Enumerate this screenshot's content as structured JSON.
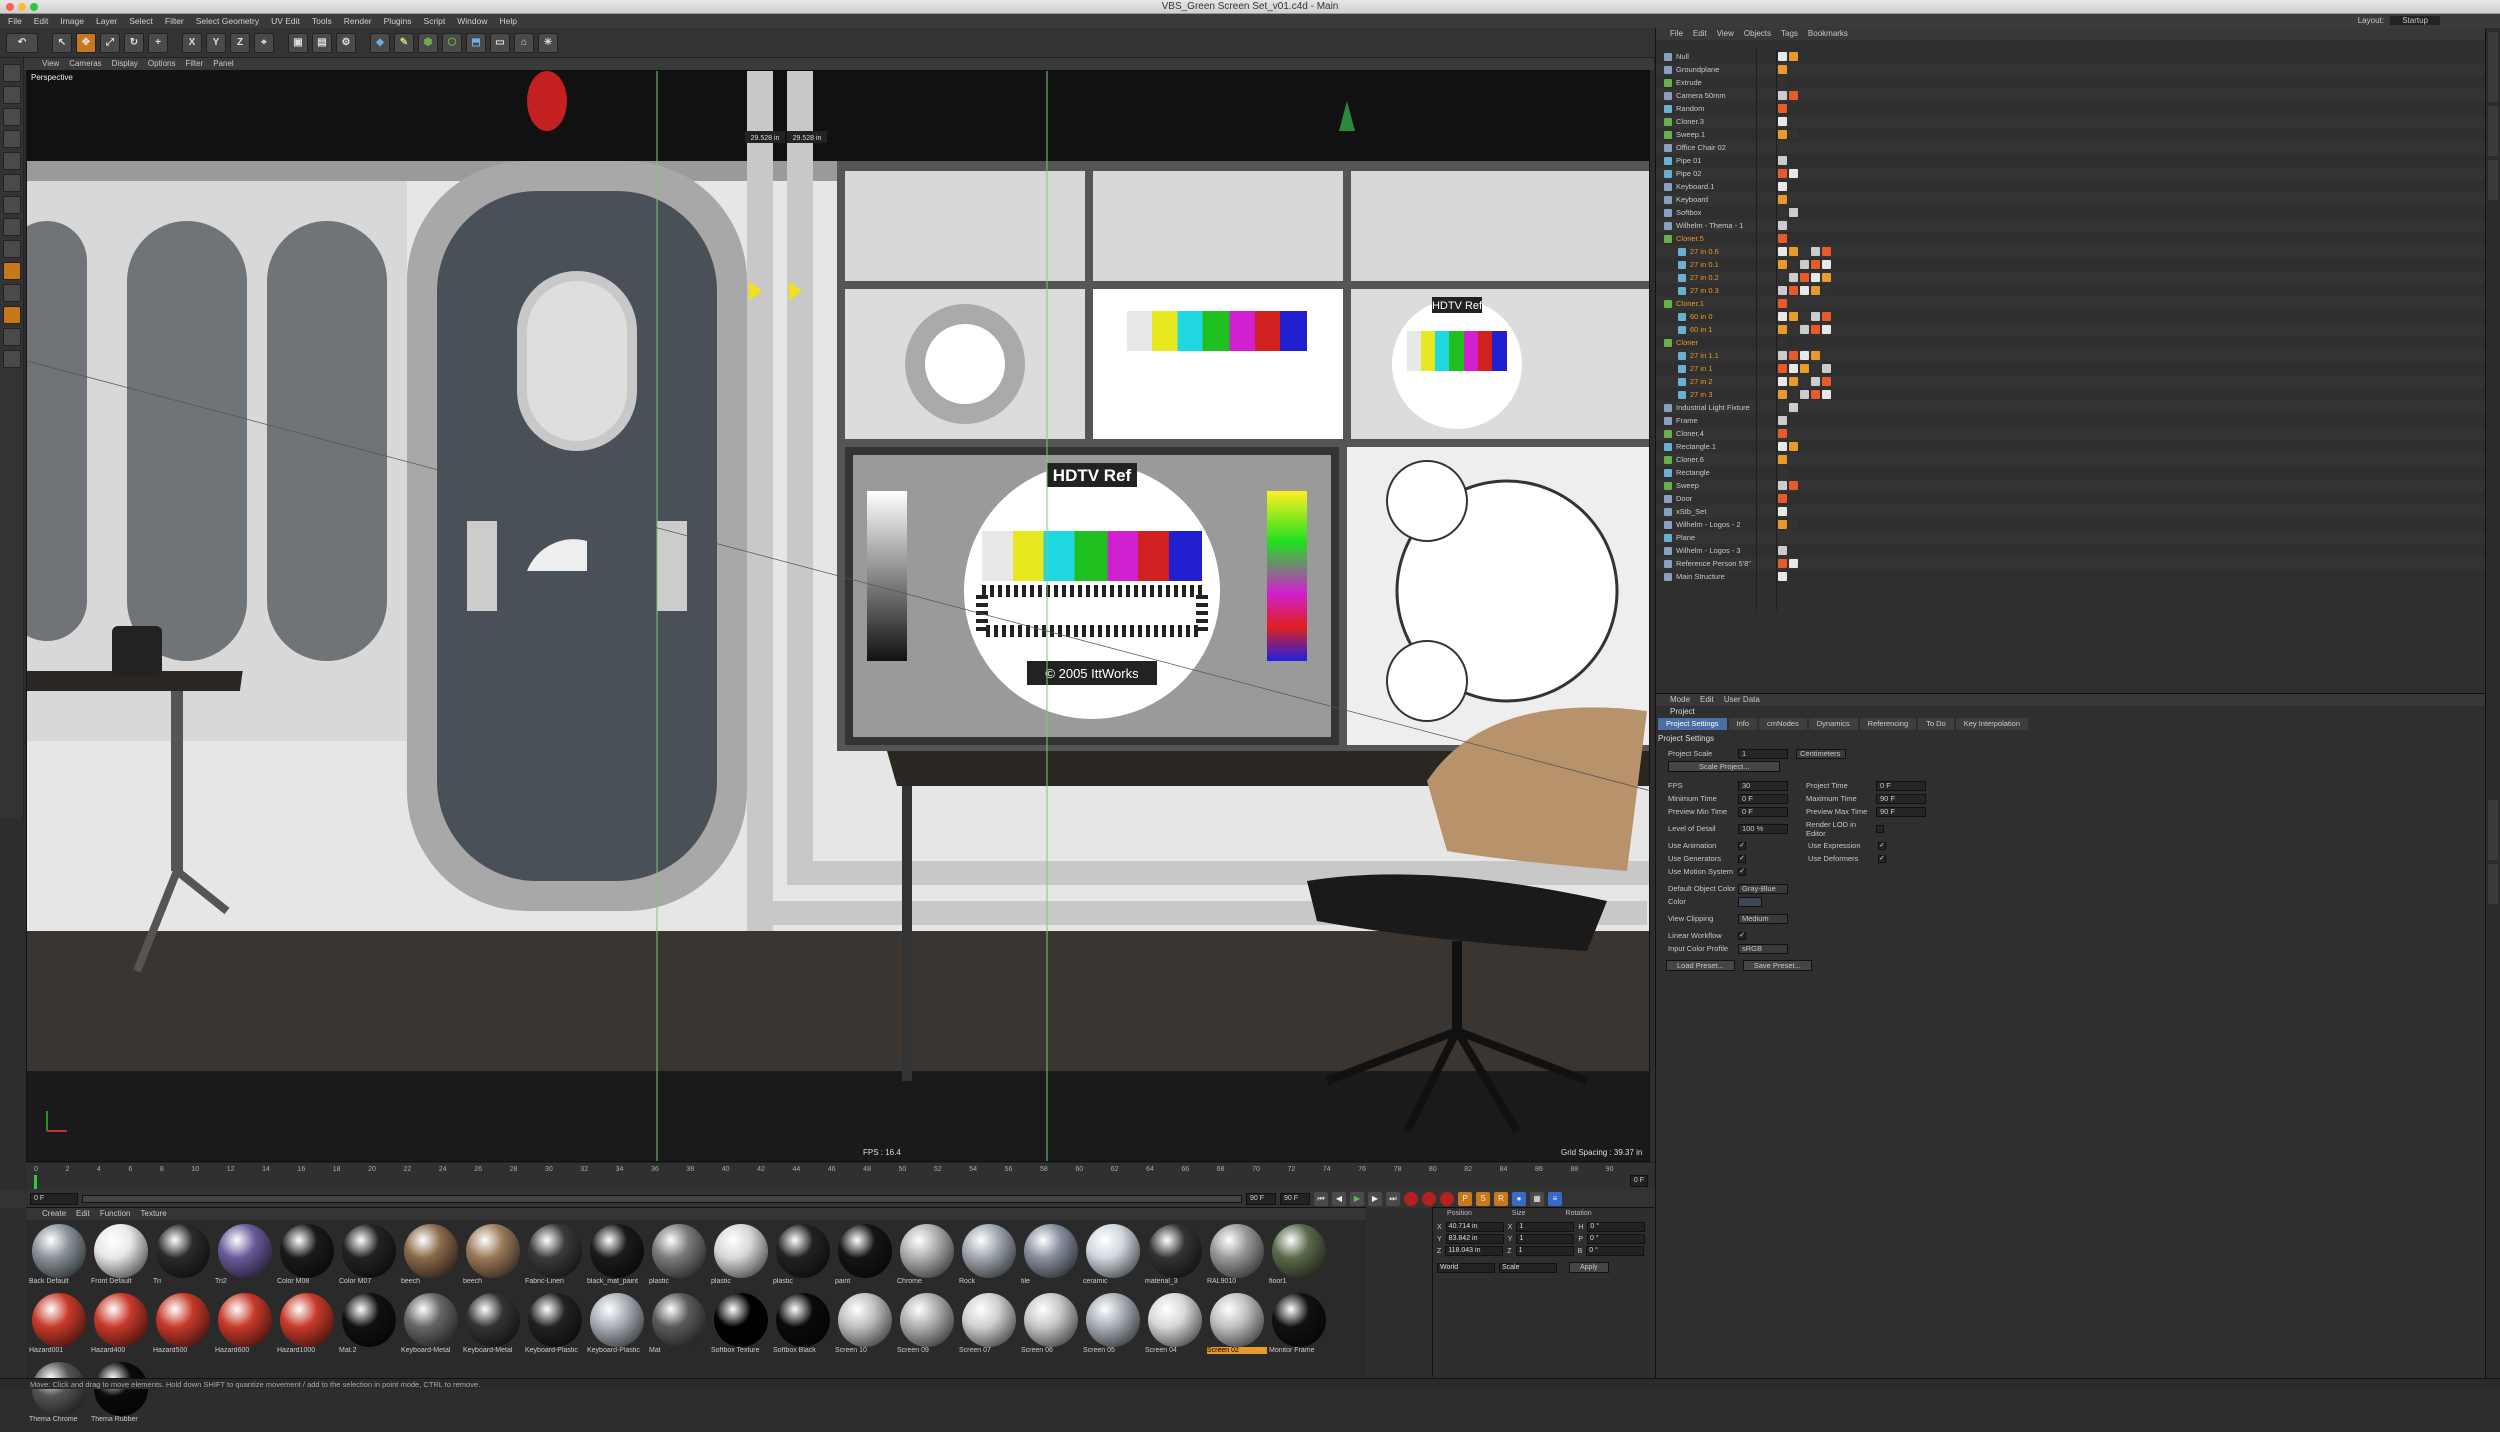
{
  "window": {
    "title": "VBS_Green Screen Set_v01.c4d - Main",
    "layout_label": "Layout:",
    "layout_value": "Startup"
  },
  "menu": [
    "File",
    "Edit",
    "Image",
    "Layer",
    "Select",
    "Filter",
    "Select Geometry",
    "UV Edit",
    "Tools",
    "Render",
    "Plugins",
    "Script",
    "Window",
    "Help"
  ],
  "toolbar": [
    "X",
    "Y",
    "Z"
  ],
  "viewport": {
    "menu": [
      "View",
      "Cameras",
      "Display",
      "Options",
      "Filter",
      "Panel"
    ],
    "label": "Perspective",
    "fps": "FPS : 16.4",
    "grid": "Grid Spacing : 39.37 in",
    "dim_a": "29.528 in",
    "dim_b": "29.528 in",
    "monitor_big": "HDTV Ref",
    "monitor_small": "HDTV Ref",
    "copyright_big": "© 2005 IttWorks",
    "copyright_small": "© 2005 IttWorks"
  },
  "timeline": {
    "ticks": [
      "0",
      "2",
      "4",
      "6",
      "8",
      "10",
      "12",
      "14",
      "16",
      "18",
      "20",
      "22",
      "24",
      "26",
      "28",
      "30",
      "32",
      "34",
      "36",
      "38",
      "40",
      "42",
      "44",
      "46",
      "48",
      "50",
      "52",
      "54",
      "56",
      "58",
      "60",
      "62",
      "64",
      "66",
      "68",
      "70",
      "72",
      "74",
      "76",
      "78",
      "80",
      "82",
      "84",
      "86",
      "88",
      "90"
    ],
    "start": "0 F",
    "current": "0 F",
    "end": "90 F",
    "end2": "90 F",
    "frame_right": "0 F"
  },
  "materials": {
    "menu": [
      "Create",
      "Edit",
      "Function",
      "Texture"
    ],
    "items": [
      {
        "name": "Back Default",
        "color": "#8a949a"
      },
      {
        "name": "Front Default",
        "color": "#e8e8e8"
      },
      {
        "name": "Tri",
        "color": "#2a2a2a"
      },
      {
        "name": "Tri2",
        "color": "#6a5a9a"
      },
      {
        "name": "Color M08",
        "color": "#1a1a1a"
      },
      {
        "name": "Color M07",
        "color": "#222"
      },
      {
        "name": "beech",
        "color": "#8a6a4a"
      },
      {
        "name": "beech",
        "color": "#9a7a5a"
      },
      {
        "name": "Fabric-Linen",
        "color": "#3a3a3a"
      },
      {
        "name": "black_mat_paint",
        "color": "#1a1a1a"
      },
      {
        "name": "plastic",
        "color": "#7a7a7a"
      },
      {
        "name": "plastic",
        "color": "#d8d8d8"
      },
      {
        "name": "plastic",
        "color": "#222"
      },
      {
        "name": "paint",
        "color": "#151515"
      },
      {
        "name": "Chrome",
        "color": "#b0b0b0"
      },
      {
        "name": "Rock",
        "color": "#a0a8b0"
      },
      {
        "name": "tile",
        "color": "#8890a0"
      },
      {
        "name": "ceramic",
        "color": "#d0d8e0"
      },
      {
        "name": "material_3",
        "color": "#333"
      },
      {
        "name": "RAL9010",
        "color": "#999"
      },
      {
        "name": "floor1",
        "color": "#5a6a4a"
      },
      {
        "name": "Hazard001",
        "color": "#c83a2a"
      },
      {
        "name": "Hazard400",
        "color": "#c83a2a"
      },
      {
        "name": "Hazard500",
        "color": "#c83a2a"
      },
      {
        "name": "Hazard600",
        "color": "#c83a2a"
      },
      {
        "name": "Hazard1000",
        "color": "#c83a2a"
      },
      {
        "name": "Mat.2",
        "color": "#111"
      },
      {
        "name": "Keyboard-Metal",
        "color": "#666"
      },
      {
        "name": "Keyboard-Metal",
        "color": "#333"
      },
      {
        "name": "Keyboard-Plastic",
        "color": "#222"
      },
      {
        "name": "Keyboard-Plastic",
        "color": "#aab0b8"
      },
      {
        "name": "Mat",
        "color": "#5a5a5a"
      },
      {
        "name": "Softbox Texture",
        "color": "#000"
      },
      {
        "name": "Softbox Black",
        "color": "#0a0a0a"
      },
      {
        "name": "Screen 10",
        "color": "#c0c0c0"
      },
      {
        "name": "Screen 09",
        "color": "#b0b0b0"
      },
      {
        "name": "Screen 07",
        "color": "#d0d0d0"
      },
      {
        "name": "Screen 06",
        "color": "#c8c8c8"
      },
      {
        "name": "Screen 05",
        "color": "#a8b0b8"
      },
      {
        "name": "Screen 04",
        "color": "#d8d8d8"
      },
      {
        "name": "Screen 02",
        "color": "#c0c0c0"
      },
      {
        "name": "Monitor Frame",
        "color": "#111"
      },
      {
        "name": "Thema Chrome",
        "color": "#555"
      },
      {
        "name": "Thema Rubber",
        "color": "#0a0a0a"
      }
    ]
  },
  "coords": {
    "headers": [
      "Position",
      "Size",
      "Rotation"
    ],
    "rows": [
      {
        "axis": "X",
        "pos": "40.714 in",
        "size": "1",
        "raxis": "H",
        "rot": "0 °"
      },
      {
        "axis": "Y",
        "pos": "83.842 in",
        "size": "1",
        "raxis": "P",
        "rot": "0 °"
      },
      {
        "axis": "Z",
        "pos": "118.043 in",
        "size": "1",
        "raxis": "B",
        "rot": "0 °"
      }
    ],
    "mode1": "World",
    "mode2": "Scale",
    "apply": "Apply"
  },
  "objects": {
    "menu": [
      "File",
      "Edit",
      "View",
      "Objects",
      "Tags",
      "Bookmarks"
    ],
    "items": [
      {
        "name": "Null",
        "orange": false,
        "icon": "#8aa0c0"
      },
      {
        "name": "Groundplane",
        "orange": false,
        "icon": "#8aa0c0"
      },
      {
        "name": "Extrude",
        "orange": false,
        "icon": "#6ab04a"
      },
      {
        "name": "Camera 50mm",
        "orange": false,
        "icon": "#8aa0c0"
      },
      {
        "name": "Random",
        "orange": false,
        "icon": "#6ab0d0"
      },
      {
        "name": "Cloner.3",
        "orange": false,
        "icon": "#6ab04a"
      },
      {
        "name": "Sweep.1",
        "orange": false,
        "icon": "#6ab04a"
      },
      {
        "name": "Office Chair 02",
        "orange": false,
        "icon": "#8aa0c0"
      },
      {
        "name": "Pipe 01",
        "orange": false,
        "icon": "#6ab0d0"
      },
      {
        "name": "Pipe 02",
        "orange": false,
        "icon": "#6ab0d0"
      },
      {
        "name": "Keyboard.1",
        "orange": false,
        "icon": "#8aa0c0"
      },
      {
        "name": "Keyboard",
        "orange": false,
        "icon": "#8aa0c0"
      },
      {
        "name": "Softbox",
        "orange": false,
        "icon": "#8aa0c0"
      },
      {
        "name": "Wilhelm - Thema - 1",
        "orange": false,
        "icon": "#8aa0c0"
      },
      {
        "name": "Cloner.5",
        "orange": true,
        "icon": "#6ab04a"
      },
      {
        "name": "27 in 0.6",
        "orange": true,
        "icon": "#6ab0d0"
      },
      {
        "name": "27 in 0.1",
        "orange": true,
        "icon": "#6ab0d0"
      },
      {
        "name": "27 in 0.2",
        "orange": true,
        "icon": "#6ab0d0"
      },
      {
        "name": "27 in 0.3",
        "orange": true,
        "icon": "#6ab0d0"
      },
      {
        "name": "Cloner.1",
        "orange": true,
        "icon": "#6ab04a"
      },
      {
        "name": "60 in 0",
        "orange": true,
        "icon": "#6ab0d0"
      },
      {
        "name": "60 in 1",
        "orange": true,
        "icon": "#6ab0d0"
      },
      {
        "name": "Cloner",
        "orange": true,
        "icon": "#6ab04a"
      },
      {
        "name": "27 in 1.1",
        "orange": true,
        "icon": "#6ab0d0"
      },
      {
        "name": "27 in 1",
        "orange": true,
        "icon": "#6ab0d0"
      },
      {
        "name": "27 in 2",
        "orange": true,
        "icon": "#6ab0d0"
      },
      {
        "name": "27 in 3",
        "orange": true,
        "icon": "#6ab0d0"
      },
      {
        "name": "Industrial Light Fixture",
        "orange": false,
        "icon": "#8aa0c0"
      },
      {
        "name": "Frame",
        "orange": false,
        "icon": "#8aa0c0"
      },
      {
        "name": "Cloner.4",
        "orange": false,
        "icon": "#6ab04a"
      },
      {
        "name": "Rectangle.1",
        "orange": false,
        "icon": "#6ab0d0"
      },
      {
        "name": "Cloner.6",
        "orange": false,
        "icon": "#6ab04a"
      },
      {
        "name": "Rectangle",
        "orange": false,
        "icon": "#6ab0d0"
      },
      {
        "name": "Sweep",
        "orange": false,
        "icon": "#6ab04a"
      },
      {
        "name": "Door",
        "orange": false,
        "icon": "#8aa0c0"
      },
      {
        "name": "xStb_Set",
        "orange": false,
        "icon": "#8aa0c0"
      },
      {
        "name": "Wilhelm - Logos - 2",
        "orange": false,
        "icon": "#8aa0c0"
      },
      {
        "name": "Plane",
        "orange": false,
        "icon": "#6ab0d0"
      },
      {
        "name": "Wilhelm - Logos - 3",
        "orange": false,
        "icon": "#8aa0c0"
      },
      {
        "name": "Reference Person 5'8\"",
        "orange": false,
        "icon": "#8aa0c0"
      },
      {
        "name": "Main Structure",
        "orange": false,
        "icon": "#8aa0c0"
      }
    ]
  },
  "attributes": {
    "menu": [
      "Mode",
      "Edit",
      "User Data"
    ],
    "title": "Project",
    "tabs": [
      "Project Settings",
      "Info",
      "cmNodes",
      "Dynamics",
      "Referencing",
      "To Do",
      "Key Interpolation"
    ],
    "section": "Project Settings",
    "scale_label": "Project Scale",
    "scale_value": "1",
    "scale_unit": "Centimeters",
    "scale_btn": "Scale Project...",
    "fps_label": "FPS",
    "fps_value": "30",
    "ptime_label": "Project Time",
    "ptime_value": "0 F",
    "mintime_label": "Minimum Time",
    "mintime_value": "0 F",
    "maxtime_label": "Maximum Time",
    "maxtime_value": "90 F",
    "pmin_label": "Preview Min Time",
    "pmin_value": "0 F",
    "pmax_label": "Preview Max Time",
    "pmax_value": "90 F",
    "lod_label": "Level of Detail",
    "lod_value": "100 %",
    "rlod_label": "Render LOD in Editor",
    "anim_label": "Use Animation",
    "expr_label": "Use Expression",
    "gen_label": "Use Generators",
    "def_label": "Use Deformers",
    "motion_label": "Use Motion System",
    "objcolor_label": "Default Object Color",
    "objcolor_value": "Gray-Blue",
    "color_label": "Color",
    "clip_label": "View Clipping",
    "clip_value": "Medium",
    "linear_label": "Linear Workflow",
    "profile_label": "Input Color Profile",
    "profile_value": "sRGB",
    "load_btn": "Load Preset...",
    "save_btn": "Save Preset..."
  },
  "status": "Move: Click and drag to move elements. Hold down SHIFT to quantize movement / add to the selection in point mode, CTRL to remove."
}
